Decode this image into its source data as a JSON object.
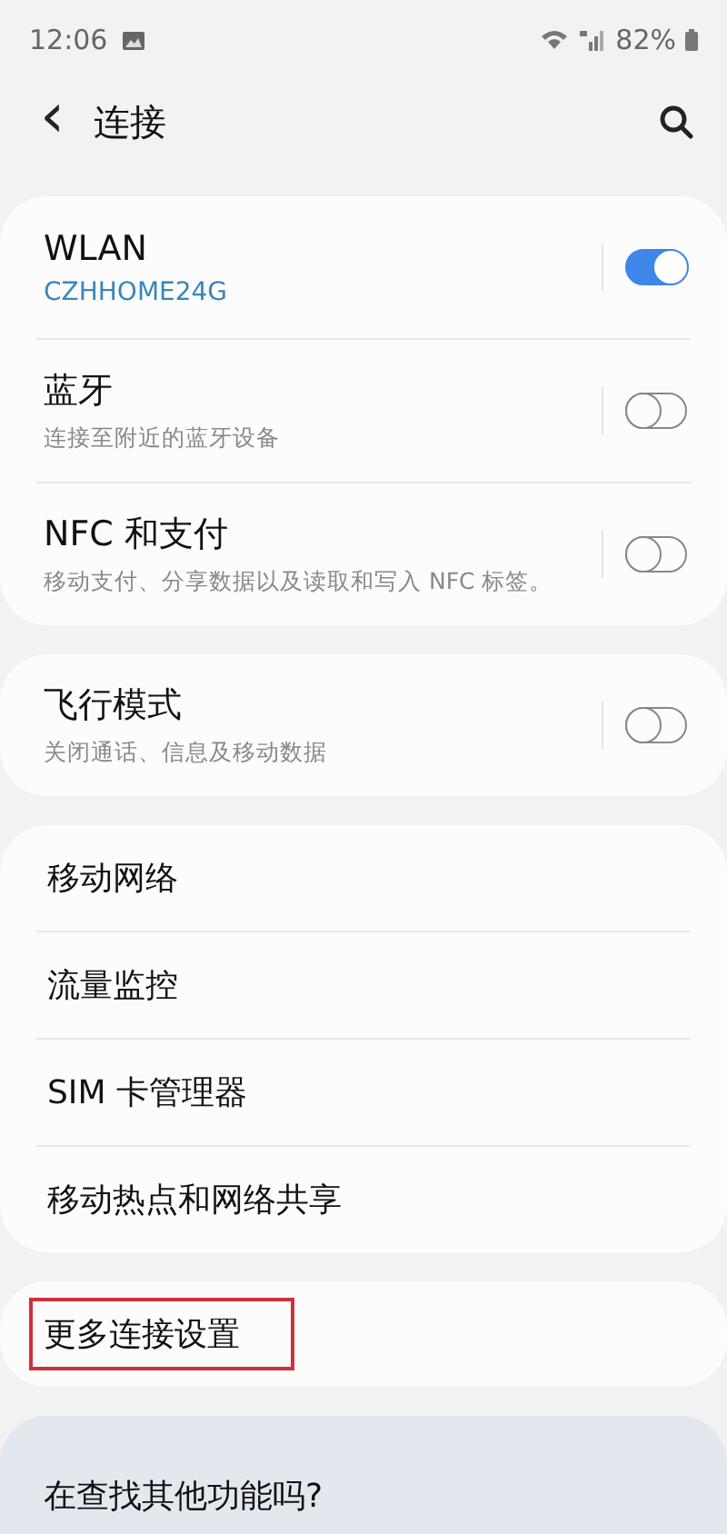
{
  "status_bar": {
    "time": "12:06",
    "battery": "82%"
  },
  "header": {
    "back": "‹",
    "title": "连接"
  },
  "groups": [
    {
      "items": [
        {
          "kind": "toggle",
          "title": "WLAN",
          "subtitle": "CZHHOME24G",
          "subtitle_accent": true,
          "on": true
        },
        {
          "kind": "toggle",
          "title": "蓝牙",
          "subtitle": "连接至附近的蓝牙设备",
          "subtitle_accent": false,
          "on": false
        },
        {
          "kind": "toggle",
          "title": "NFC 和支付",
          "subtitle": "移动支付、分享数据以及读取和写入 NFC 标签。",
          "subtitle_accent": false,
          "on": false
        }
      ]
    },
    {
      "items": [
        {
          "kind": "toggle",
          "title": "飞行模式",
          "subtitle": "关闭通话、信息及移动数据",
          "subtitle_accent": false,
          "on": false
        }
      ]
    },
    {
      "items": [
        {
          "kind": "link",
          "title": "移动网络",
          "highlighted": false
        },
        {
          "kind": "link",
          "title": "流量监控",
          "highlighted": false
        },
        {
          "kind": "link",
          "title": "SIM 卡管理器",
          "highlighted": false
        },
        {
          "kind": "link",
          "title": "移动热点和网络共享",
          "highlighted": false
        }
      ]
    },
    {
      "items": [
        {
          "kind": "link",
          "title": "更多连接设置",
          "highlighted": true
        }
      ]
    }
  ],
  "suggestion": {
    "title": "在查找其他功能吗?"
  }
}
